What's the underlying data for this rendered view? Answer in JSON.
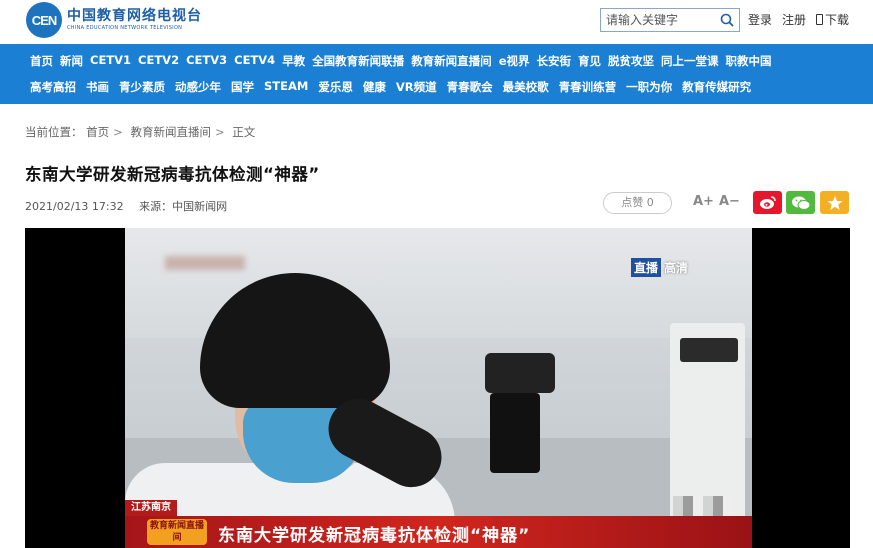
{
  "header": {
    "logo_mark": "CEN",
    "logo_cn": "中国教育网络电视台",
    "logo_en": "CHINA EDUCATION NETWORK TELEVISION",
    "search_placeholder": "请输入关键字",
    "login": "登录",
    "register": "注册",
    "download": "下载"
  },
  "nav": {
    "row1": [
      "首页",
      "新闻",
      "CETV1",
      "CETV2",
      "CETV3",
      "CETV4",
      "早教",
      "全国教育新闻联播",
      "教育新闻直播间",
      "e视界",
      "长安街",
      "育见",
      "脱贫攻坚",
      "同上一堂课",
      "职教中国"
    ],
    "row2": [
      "高考高招",
      "书画",
      "青少素质",
      "动感少年",
      "国学",
      "STEAM",
      "爱乐恩",
      "健康",
      "VR频道",
      "青春歌会",
      "最美校歌",
      "青春训练营",
      "一职为你",
      "教育传媒研究"
    ]
  },
  "breadcrumb": {
    "prefix": "当前位置：",
    "items": [
      "首页",
      "教育新闻直播间",
      "正文"
    ]
  },
  "article": {
    "title": "东南大学研发新冠病毒抗体检测“神器”",
    "date": "2021/02/13 17:32",
    "source_label": "来源：",
    "source": "中国新闻网",
    "like_label": "点赞 0",
    "font_up": "A+",
    "font_down": "A−"
  },
  "video": {
    "live_tag": "直播",
    "hd_tag": "高清",
    "location": "江苏南京",
    "badge": "教育新闻直播间",
    "caption": "东南大学研发新冠病毒抗体检测“神器”"
  },
  "colors": {
    "nav_bg": "#1b7fd3",
    "weibo": "#e6162d",
    "wechat": "#52b93e",
    "favorite": "#f4b024",
    "caption_bar": "#c41f1b"
  }
}
